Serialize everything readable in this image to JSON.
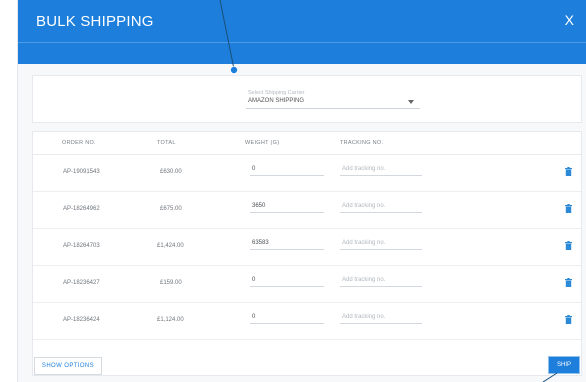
{
  "modal": {
    "title": "BULK SHIPPING",
    "close_label": "X"
  },
  "carrier": {
    "label": "Select Shipping Carrier",
    "selected": "AMAZON SHIPPING"
  },
  "table": {
    "headers": [
      "ORDER NO.",
      "TOTAL",
      "WEIGHT (G)",
      "TRACKING NO."
    ],
    "rows": [
      {
        "order": "AP-19091543",
        "total": "£630.00",
        "weight": "0",
        "tracking_placeholder": "Add tracking no."
      },
      {
        "order": "AP-18264962",
        "total": "£675.00",
        "weight": "3650",
        "tracking_placeholder": "Add tracking no."
      },
      {
        "order": "AP-18264703",
        "total": "£1,424.00",
        "weight": "63583",
        "tracking_placeholder": "Add tracking no."
      },
      {
        "order": "AP-18236427",
        "total": "£159.00",
        "weight": "0",
        "tracking_placeholder": "Add tracking no."
      },
      {
        "order": "AP-18236424",
        "total": "£1,124.00",
        "weight": "0",
        "tracking_placeholder": "Add tracking no."
      }
    ]
  },
  "footer": {
    "show_options_label": "SHOW OPTIONS",
    "ship_label": "SHIP"
  },
  "colors": {
    "accent": "#1d7fdb",
    "trash": "#2b8ad8",
    "annotation": "#1a4f7a"
  },
  "icons": {
    "row_delete": "trash-icon"
  }
}
